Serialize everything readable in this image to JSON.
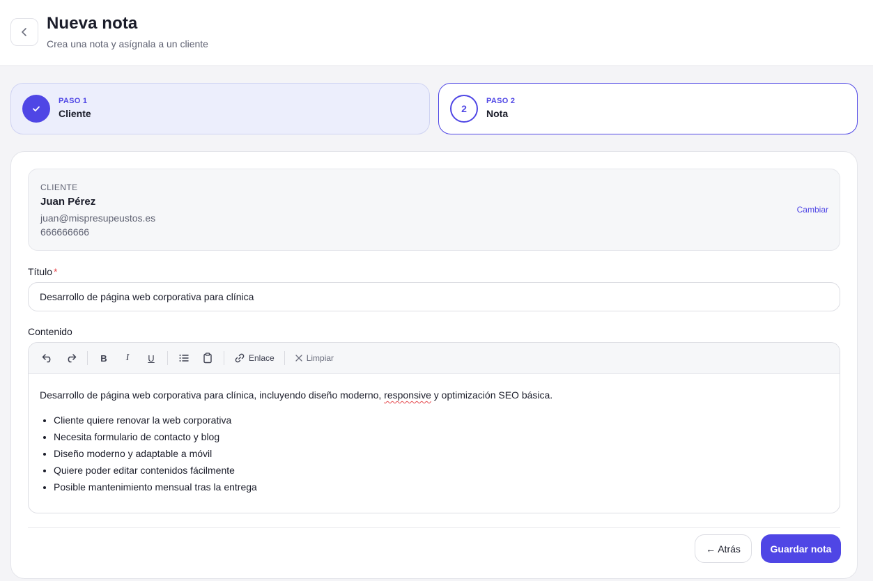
{
  "header": {
    "title": "Nueva nota",
    "subtitle": "Crea una nota y asígnala a un cliente"
  },
  "steps": [
    {
      "kicker": "PASO 1",
      "label": "Cliente",
      "state": "completed"
    },
    {
      "kicker": "PASO 2",
      "label": "Nota",
      "number": "2",
      "state": "active"
    }
  ],
  "client": {
    "section_label": "CLIENTE",
    "name": "Juan Pérez",
    "email": "juan@mispresupeustos.es",
    "phone": "666666666",
    "change_label": "Cambiar"
  },
  "form": {
    "title_label": "Título",
    "required_mark": "*",
    "title_value": "Desarrollo de página web corporativa para clínica",
    "content_label": "Contenido"
  },
  "toolbar": {
    "link_label": "Enlace",
    "clear_label": "Limpiar"
  },
  "editor": {
    "paragraph_before": "Desarrollo de página web corporativa para clínica, incluyendo diseño moderno, ",
    "misspelled_word": "responsive",
    "paragraph_after": " y optimización SEO básica.",
    "bullets": [
      "Cliente quiere renovar la web corporativa",
      "Necesita formulario de contacto y blog",
      "Diseño moderno y adaptable a móvil",
      "Quiere poder editar contenidos fácilmente",
      "Posible mantenimiento mensual tras la entrega"
    ]
  },
  "actions": {
    "back_label": "← Atrás",
    "save_label": "Guardar nota"
  },
  "colors": {
    "accent": "#4f46e5",
    "step_done_bg": "#eceefc"
  }
}
